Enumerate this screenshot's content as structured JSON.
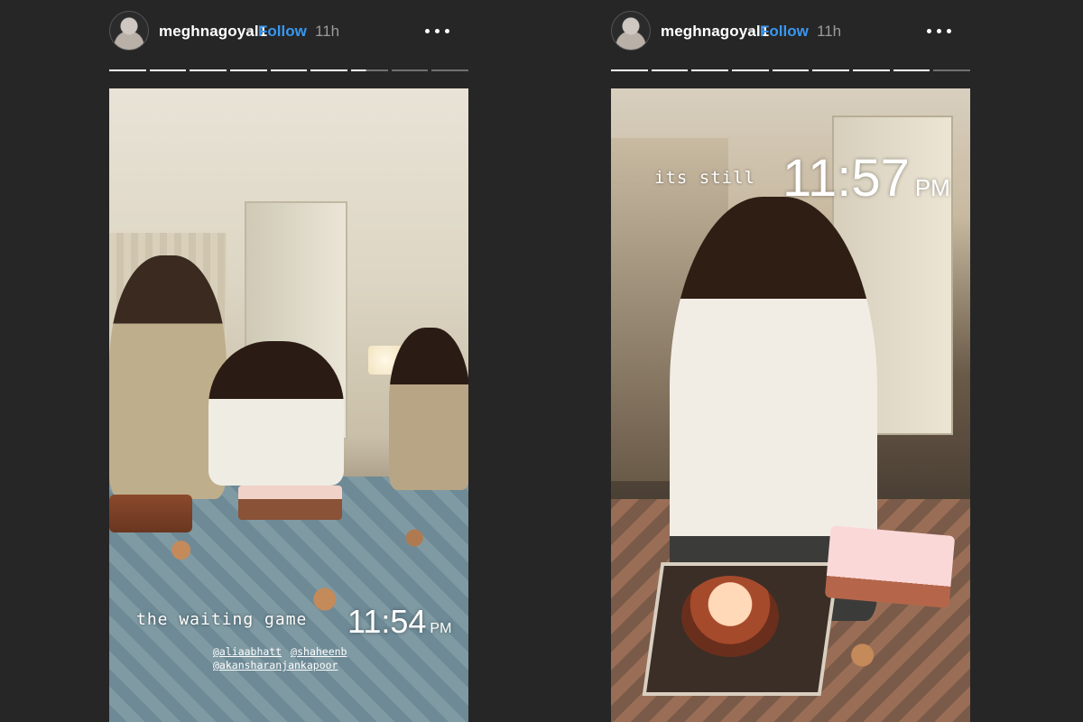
{
  "stories": [
    {
      "username": "meghnagoyal1",
      "separator": "•",
      "follow_label": "Follow",
      "time_ago": "11h",
      "progress": {
        "segments": 9,
        "completed": 6,
        "current_fraction": 0.4
      },
      "caption": "the waiting game",
      "clock": "11:54",
      "clock_suffix": "PM",
      "mentions": [
        "@aliaabhatt",
        "@shaheenb",
        "@akansharanjankapoor"
      ]
    },
    {
      "username": "meghnagoyal1",
      "separator": "•",
      "follow_label": "Follow",
      "time_ago": "11h",
      "progress": {
        "segments": 9,
        "completed": 8,
        "current_fraction": 0.0
      },
      "caption": "its still",
      "clock": "11:57",
      "clock_suffix": "PM"
    }
  ],
  "colors": {
    "background": "#262626",
    "follow": "#3897f0",
    "time": "#9a9a9a"
  },
  "icons": {
    "more": "more-horizontal-icon"
  }
}
